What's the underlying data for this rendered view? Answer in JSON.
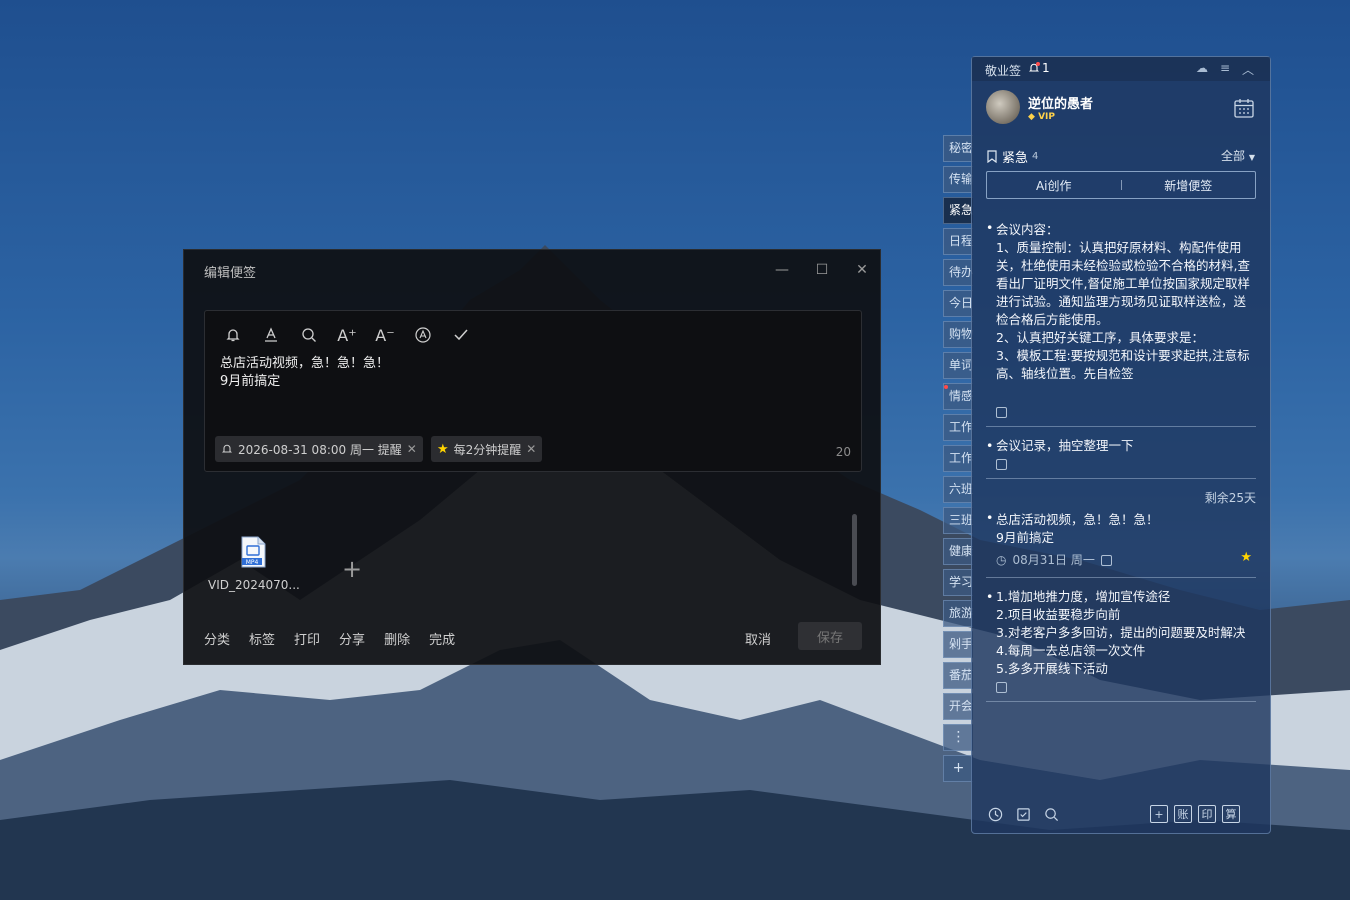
{
  "editor": {
    "title": "编辑便签",
    "window_buttons": [
      "minimize",
      "maximize",
      "close"
    ],
    "toolbar_icons": [
      "bell-icon",
      "font-color-icon",
      "search-icon",
      "font-increase-icon",
      "font-decrease-icon",
      "ai-icon",
      "check-icon"
    ],
    "toolbar_symbols": {
      "font_increase": "A⁺",
      "font_decrease": "A⁻"
    },
    "content_lines": [
      "总店活动视频，急！急！急！",
      "9月前搞定"
    ],
    "reminder_chip": "2026-08-31 08:00 周一 提醒",
    "repeat_chip": "每2分钟提醒",
    "char_count": "20",
    "attachment": {
      "name": "VID_2024070...",
      "badge": "MP4"
    },
    "add_symbol": "+",
    "actions": [
      "分类",
      "标签",
      "打印",
      "分享",
      "删除",
      "完成"
    ],
    "cancel": "取消",
    "save": "保存"
  },
  "vertical_tabs": [
    "秘密",
    "传输",
    "紧急",
    "日程",
    "待办",
    "今日",
    "购物",
    "单词",
    "情感",
    "工作",
    "工作",
    "六班",
    "三班",
    "健康",
    "学习",
    "旅游",
    "剁手",
    "番茄",
    "开会"
  ],
  "vertical_tab_active": "紧急",
  "vertical_tab_more": "⋮",
  "vertical_tab_add": "+",
  "panel": {
    "app_name": "敬业签",
    "notify_count": "1",
    "user_name": "逆位的愚者",
    "vip_label": "VIP",
    "category": "紧急",
    "category_count": "4",
    "filter": "全部",
    "ai_button": "Ai创作",
    "new_button": "新增便签",
    "notes": [
      {
        "text": "会议内容：\n1、质量控制：认真把好原材料、构配件使用关，杜绝使用未经检验或检验不合格的材料,查看出厂证明文件,督促施工单位按国家规定取样进行试验。通知监理方现场见证取样送检，送检合格后方能使用。\n2、认真把好关键工序，具体要求是：\n3、模板工程:要按规范和设计要求起拱,注意标高、轴线位置。先自检签"
      },
      {
        "text": "会议记录，抽空整理一下"
      },
      {
        "remaining": "剩余25天",
        "text": "总店活动视频，急！急！急！\n9月前搞定",
        "date": "08月31日 周一"
      },
      {
        "text": "1.增加地推力度，增加宣传途径\n2.项目收益要稳步向前\n3.对老客户多多回访，提出的问题要及时解决\n4.每周一去总店领一次文件\n5.多多开展线下活动"
      }
    ],
    "bottom_right_labels": [
      "+",
      "账",
      "印",
      "算"
    ]
  }
}
